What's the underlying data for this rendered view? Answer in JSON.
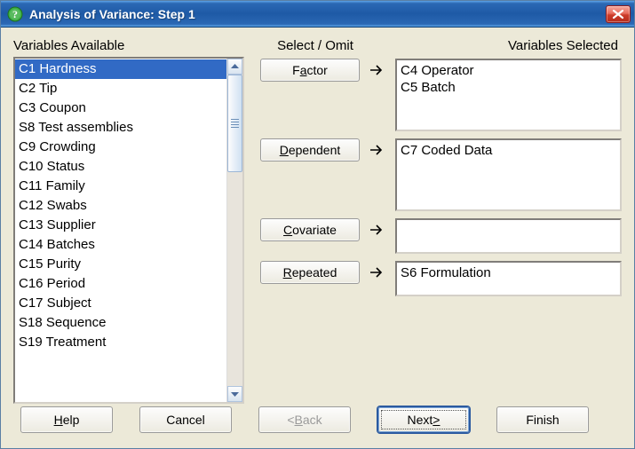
{
  "window": {
    "title": "Analysis of Variance: Step 1"
  },
  "labels": {
    "available": "Variables Available",
    "select_omit": "Select / Omit",
    "selected": "Variables Selected"
  },
  "buttons": {
    "factor_pre": "F",
    "factor_u": "a",
    "factor_post": "ctor",
    "dependent_pre": "",
    "dependent_u": "D",
    "dependent_post": "ependent",
    "covariate_pre": "",
    "covariate_u": "C",
    "covariate_post": "ovariate",
    "repeated_pre": "",
    "repeated_u": "R",
    "repeated_post": "epeated",
    "help_pre": "",
    "help_u": "H",
    "help_post": "elp",
    "cancel": "Cancel",
    "back_pre": "< ",
    "back_u": "B",
    "back_post": "ack",
    "next_pre": "Next ",
    "next_u": ">",
    "next_post": "",
    "finish": "Finish"
  },
  "available": [
    {
      "label": "C1 Hardness",
      "selected": true
    },
    {
      "label": "C2 Tip"
    },
    {
      "label": "C3 Coupon"
    },
    {
      "label": "S8 Test assemblies"
    },
    {
      "label": "C9 Crowding"
    },
    {
      "label": "C10 Status"
    },
    {
      "label": "C11 Family"
    },
    {
      "label": "C12 Swabs"
    },
    {
      "label": "C13 Supplier"
    },
    {
      "label": "C14 Batches"
    },
    {
      "label": "C15 Purity"
    },
    {
      "label": "C16 Period"
    },
    {
      "label": "C17 Subject"
    },
    {
      "label": "S18 Sequence"
    },
    {
      "label": "S19 Treatment"
    }
  ],
  "selected": {
    "factor": [
      "C4 Operator",
      "C5 Batch"
    ],
    "dependent": [
      "C7 Coded Data"
    ],
    "covariate": [],
    "repeated": [
      "S6 Formulation"
    ]
  }
}
